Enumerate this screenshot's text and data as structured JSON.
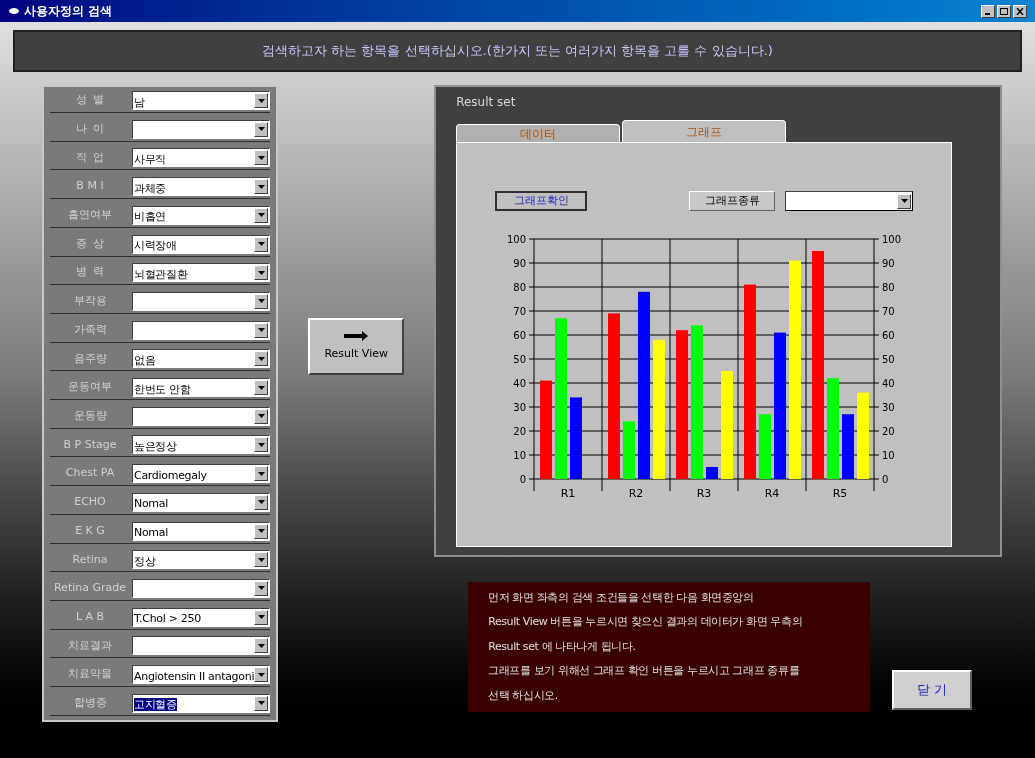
{
  "window": {
    "title": "사용자정의 검색"
  },
  "instruction": "검색하고자 하는 항목을 선택하십시오.(한가지 또는 여러가지 항목을 고를 수 있습니다.)",
  "criteria": [
    {
      "label": "성  별",
      "value": "남"
    },
    {
      "label": "나  이"
    },
    {
      "label": "직  업",
      "value": "사무직"
    },
    {
      "label": "B M I",
      "value": "과체중"
    },
    {
      "label": "흡연여부",
      "value": "비흡연"
    },
    {
      "label": "증  상",
      "value": "시력장애"
    },
    {
      "label": "병  력",
      "value": "뇌혈관질환"
    },
    {
      "label": "부작용"
    },
    {
      "label": "가족력"
    },
    {
      "label": "음주량",
      "value": "없음"
    },
    {
      "label": "운동여부",
      "value": "한번도 안함"
    },
    {
      "label": "운동량"
    },
    {
      "label": "B P Stage",
      "value": "높은정상"
    },
    {
      "label": "Chest PA",
      "value": "Cardiomegaly"
    },
    {
      "label": "ECHO",
      "value": "Nomal"
    },
    {
      "label": "E K G",
      "value": "Nomal"
    },
    {
      "label": "Retina",
      "value": "정상"
    },
    {
      "label": "Retina Grade"
    },
    {
      "label": "L A B",
      "value": "T.Chol > 250"
    },
    {
      "label": "치료결과"
    },
    {
      "label": "치료약물",
      "value": "Angiotensin II antagoni"
    },
    {
      "label": "합병증",
      "value": "고지혈증",
      "highlighted": true
    }
  ],
  "result_view_button": "Result View",
  "result_set": {
    "title": "Result set",
    "tabs": [
      {
        "label": "데이터",
        "selected": false
      },
      {
        "label": "그래프",
        "selected": true
      }
    ],
    "graph_check_button": "그래프확인",
    "graph_type_button": "그래프종류",
    "chart_data": {
      "type": "bar",
      "categories": [
        "R1",
        "R2",
        "R3",
        "R4",
        "R5"
      ],
      "ylim": [
        0,
        100
      ],
      "grid": true,
      "yticks": [
        0,
        10,
        20,
        30,
        40,
        50,
        60,
        70,
        80,
        90,
        100
      ],
      "y2ticks": [
        0,
        10,
        20,
        30,
        40,
        50,
        60,
        70,
        80,
        90,
        100
      ],
      "y2lim": [
        0,
        100
      ],
      "series": [
        {
          "color": "#ff0000",
          "values": [
            41,
            69,
            62,
            81,
            95
          ]
        },
        {
          "color": "#00ff00",
          "values": [
            67,
            24,
            64,
            27,
            42
          ]
        },
        {
          "color": "#0000ff",
          "values": [
            34,
            78,
            5,
            61,
            27
          ]
        },
        {
          "color": "#ffff00",
          "values": [
            null,
            58,
            45,
            91,
            36
          ]
        }
      ]
    }
  },
  "help_lines": [
    "먼저 화면 좌측의 검색 조건들을 선택한 다음 화면중앙의",
    "Result View 버튼을 누르시면 찾으신 결과의 데이터가 화면 우측의",
    "Result set 에 나타나게 됩니다.",
    "그래프를 보기 위해선 그래프 확인 버튼을 누르시고 그래프 종류를",
    "선택 하십시오."
  ],
  "close_button": "닫 기"
}
